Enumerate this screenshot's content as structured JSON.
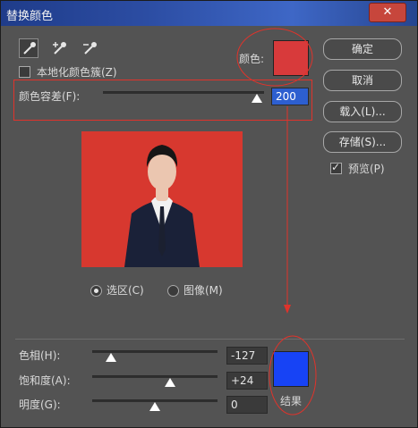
{
  "window": {
    "title": "替换颜色",
    "close_label": "✕"
  },
  "tools": {
    "eyedropper": "eyedropper-icon",
    "add": "eyedropper-plus-icon",
    "subtract": "eyedropper-minus-icon"
  },
  "selection": {
    "localized_label": "本地化颜色簇(Z)",
    "color_label": "颜色:",
    "color_hex": "#d83a3b",
    "fuzziness_label": "颜色容差(F):",
    "fuzziness_value": "200",
    "fuzziness_fraction": 1.0
  },
  "preview_mode": {
    "selection_label": "选区(C)",
    "image_label": "图像(M)",
    "selected": "selection"
  },
  "buttons": {
    "ok": "确定",
    "cancel": "取消",
    "load": "载入(L)...",
    "save": "存储(S)..."
  },
  "preview_checkbox": {
    "label": "预览(P)",
    "checked": true
  },
  "replacement": {
    "hue_label": "色相(H):",
    "hue_value": "-127",
    "hue_fraction": 0.147,
    "saturation_label": "饱和度(A):",
    "saturation_value": "+24",
    "saturation_fraction": 0.62,
    "lightness_label": "明度(G):",
    "lightness_value": "0",
    "lightness_fraction": 0.5,
    "result_label": "结果",
    "result_hex": "#1743f5"
  },
  "photo": {
    "background_hex": "#d7382f",
    "suit_hex": "#1a2138",
    "shirt_hex": "#f1f1f1",
    "skin_hex": "#ebc6b0",
    "hair_hex": "#161616"
  },
  "annotation_color": "#e0332b"
}
